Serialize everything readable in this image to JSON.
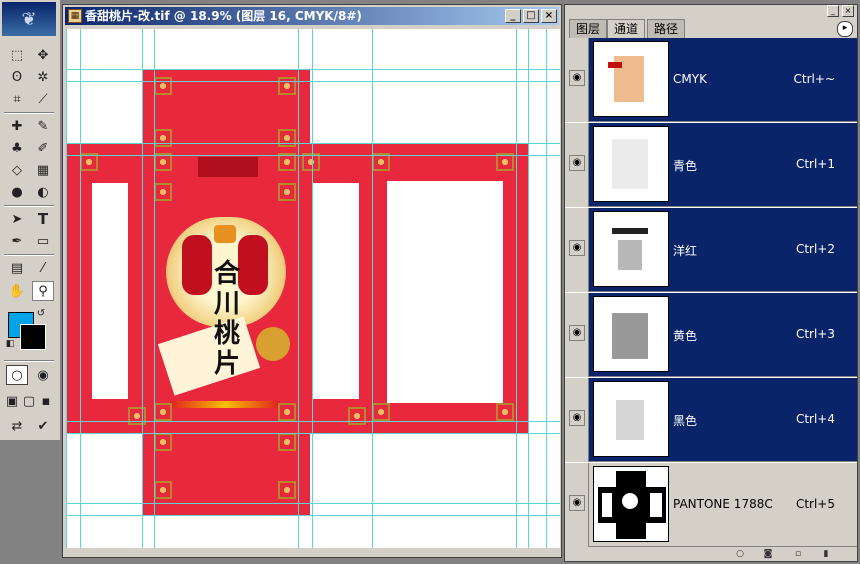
{
  "document": {
    "title": "香甜桃片-改.tif @ 18.9% (图层 16, CMYK/8#)",
    "file_icon": "file-icon",
    "product_name": "合川桃片",
    "controls": {
      "minimize": "_",
      "maximize": "□",
      "close": "×"
    }
  },
  "toolbox": {
    "tools": [
      "marquee-icon",
      "move-icon",
      "lasso-icon",
      "magic-wand-icon",
      "crop-icon",
      "slice-icon",
      "healing-icon",
      "brush-icon",
      "stamp-icon",
      "history-brush-icon",
      "eraser-icon",
      "gradient-icon",
      "blur-icon",
      "dodge-icon",
      "path-select-icon",
      "type-icon",
      "pen-icon",
      "shape-icon",
      "notes-icon",
      "eyedropper-icon",
      "hand-icon",
      "zoom-icon"
    ],
    "foreground_color": "#00a2e8",
    "background_color": "#000000"
  },
  "panel": {
    "tabs": [
      "图层",
      "通道",
      "路径"
    ],
    "active_tab": "通道",
    "menu_icon": "▸",
    "channels": [
      {
        "name": "CMYK",
        "shortcut": "Ctrl+~"
      },
      {
        "name": "青色",
        "shortcut": "Ctrl+1"
      },
      {
        "name": "洋红",
        "shortcut": "Ctrl+2"
      },
      {
        "name": "黄色",
        "shortcut": "Ctrl+3"
      },
      {
        "name": "黑色",
        "shortcut": "Ctrl+4"
      },
      {
        "name": "PANTONE 1788C",
        "shortcut": "Ctrl+5"
      }
    ],
    "footer_icons": [
      "load-selection-icon",
      "save-selection-icon",
      "new-channel-icon",
      "delete-channel-icon"
    ]
  }
}
